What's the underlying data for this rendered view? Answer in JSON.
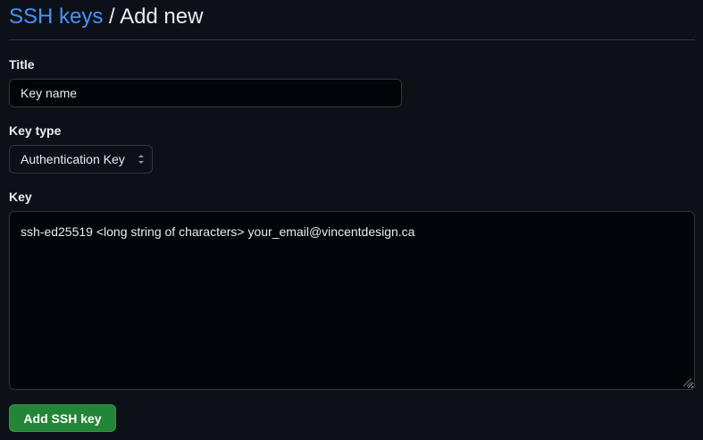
{
  "breadcrumb": {
    "parent_link": "SSH keys",
    "separator": " / ",
    "current": "Add new"
  },
  "form": {
    "title_label": "Title",
    "title_value": "Key name",
    "key_type_label": "Key type",
    "key_type_selected": "Authentication Key",
    "key_label": "Key",
    "key_value": "ssh-ed25519 <long string of characters> your_email@vincentdesign.ca",
    "submit_label": "Add SSH key"
  },
  "colors": {
    "background": "#0d1117",
    "input_background": "#010409",
    "border": "#30363d",
    "link": "#4493f8",
    "text": "#e6edf3",
    "primary_button": "#238636"
  },
  "icons": {
    "select_arrow": "chevron-up-down-icon",
    "resize_handle": "resize-handle-icon"
  }
}
